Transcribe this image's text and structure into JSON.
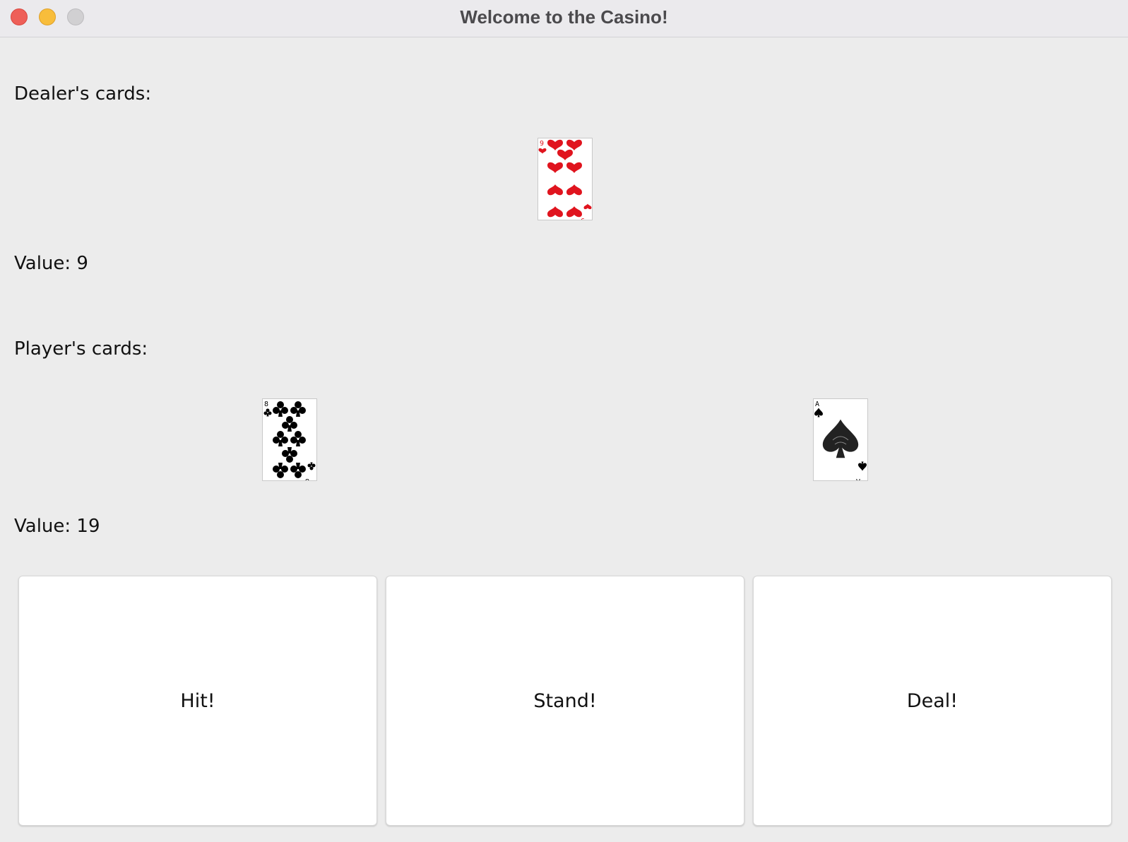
{
  "window": {
    "title": "Welcome to the Casino!"
  },
  "dealer": {
    "heading": "Dealer's cards:",
    "cards": [
      {
        "rank": "9",
        "suit": "hearts"
      }
    ],
    "value_text": "Value: 9"
  },
  "player": {
    "heading": "Player's cards:",
    "cards": [
      {
        "rank": "8",
        "suit": "clubs"
      },
      {
        "rank": "A",
        "suit": "spades"
      }
    ],
    "value_text": "Value: 19"
  },
  "buttons": {
    "hit": "Hit!",
    "stand": "Stand!",
    "deal": "Deal!"
  },
  "colors": {
    "red_suit": "#e0141e",
    "black_suit": "#000000"
  },
  "icons": {
    "hearts": "heart-icon",
    "clubs": "club-icon",
    "spades": "spade-icon"
  }
}
